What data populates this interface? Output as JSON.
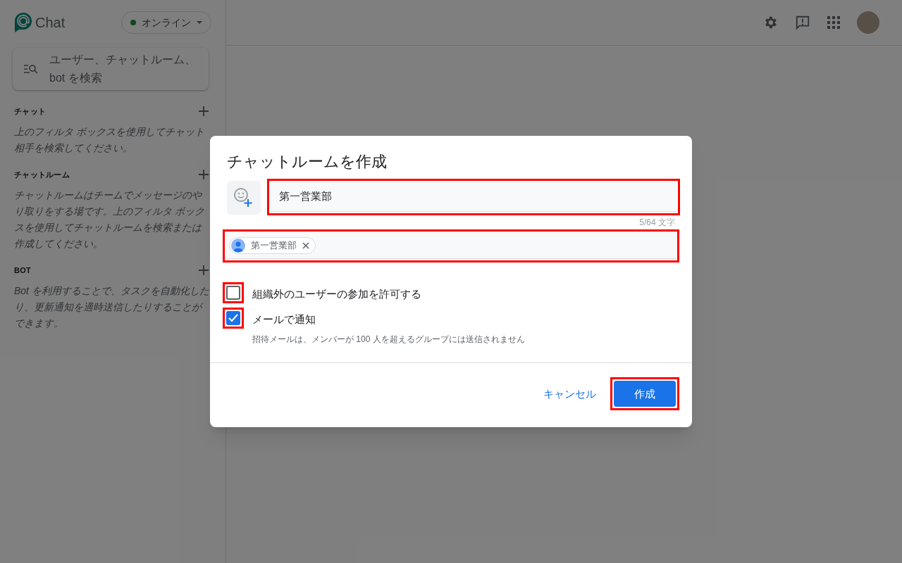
{
  "app": {
    "name": "Chat"
  },
  "status": {
    "label": "オンライン",
    "color": "#0f471f"
  },
  "search": {
    "placeholder": "ユーザー、チャットルーム、bot を検索"
  },
  "sections": [
    {
      "title": "チャット",
      "description": "上のフィルタ ボックスを使用してチャット相手を検索してください。"
    },
    {
      "title": "チャットルーム",
      "description": "チャットルームはチームでメッセージのやり取りをする場です。上のフィルタ ボックスを使用してチャットルームを検索または作成してください。"
    },
    {
      "title": "BOT",
      "description": "Bot を利用することで、タスクを自動化したり、更新通知を適時送信したりすることができます。"
    }
  ],
  "dialog": {
    "title": "チャットルームを作成",
    "name_field": {
      "value": "第一営業部",
      "counter": "5/64 文字",
      "highlighted": true
    },
    "members_field": {
      "highlighted": true,
      "chips": [
        {
          "label": "第一営業部"
        }
      ]
    },
    "options": [
      {
        "label": "組織外のユーザーの参加を許可する",
        "checked": false,
        "highlighted": true
      },
      {
        "label": "メールで通知",
        "checked": true,
        "highlighted": true,
        "hint": "招待メールは、メンバーが 100 人を超えるグループには送信されません"
      }
    ],
    "cancel_button": {
      "label": "キャンセル"
    },
    "create_button": {
      "label": "作成",
      "highlighted": true
    }
  }
}
